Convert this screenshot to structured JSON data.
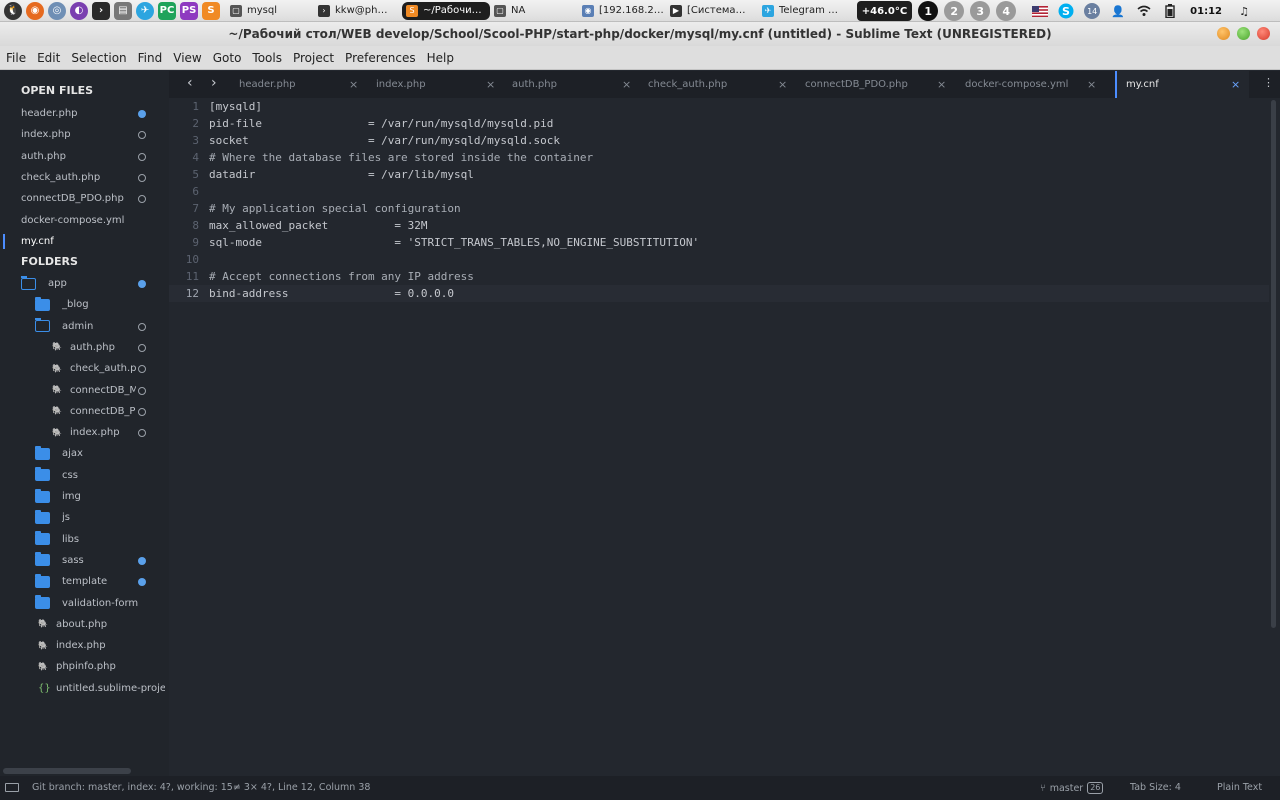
{
  "taskbar": {
    "windows": [
      {
        "label": "mysql",
        "icon_color": "#555555",
        "icon_glyph": "▢"
      },
      {
        "label": "kkw@ph…",
        "icon_color": "#333333",
        "icon_glyph": "›"
      },
      {
        "label": "~/Рабочи…",
        "icon_color": "#f08a24",
        "icon_glyph": "S"
      },
      {
        "label": "NA",
        "icon_color": "#555555",
        "icon_glyph": "▢"
      },
      {
        "label": "[192.168.2…",
        "icon_color": "#5a7fb5",
        "icon_glyph": "◉"
      },
      {
        "label": "[Система…",
        "icon_color": "#333333",
        "icon_glyph": "▶"
      },
      {
        "label": "Telegram …",
        "icon_color": "#2ca5e0",
        "icon_glyph": "✈"
      }
    ],
    "temperature": "+46.0°C",
    "workspaces": [
      "1",
      "2",
      "3",
      "4"
    ],
    "tray_badge": "14",
    "clock": "01:12"
  },
  "title": "~/Рабочий стол/WEB develop/School/Scool-PHP/start-php/docker/mysql/my.cnf (untitled) - Sublime Text (UNREGISTERED)",
  "menu": [
    "File",
    "Edit",
    "Selection",
    "Find",
    "View",
    "Goto",
    "Tools",
    "Project",
    "Preferences",
    "Help"
  ],
  "sidebar": {
    "open_files_heading": "OPEN FILES",
    "open_files": [
      {
        "name": "header.php",
        "status": "modified"
      },
      {
        "name": "index.php",
        "status": "open"
      },
      {
        "name": "auth.php",
        "status": "open"
      },
      {
        "name": "check_auth.php",
        "status": "open"
      },
      {
        "name": "connectDB_PDO.php",
        "status": "open"
      },
      {
        "name": "docker-compose.yml",
        "status": "none"
      },
      {
        "name": "my.cnf",
        "status": "active"
      }
    ],
    "folders_heading": "FOLDERS",
    "tree": [
      {
        "name": "app",
        "kind": "folder-open",
        "indent": 0,
        "status": "modified"
      },
      {
        "name": "_blog",
        "kind": "folder",
        "indent": 1,
        "status": "none"
      },
      {
        "name": "admin",
        "kind": "folder-open",
        "indent": 1,
        "status": "open"
      },
      {
        "name": "auth.php",
        "kind": "php",
        "indent": 2,
        "status": "open"
      },
      {
        "name": "check_auth.php",
        "kind": "php",
        "indent": 2,
        "status": "open"
      },
      {
        "name": "connectDB_MYSQL.php",
        "kind": "php",
        "indent": 2,
        "status": "open"
      },
      {
        "name": "connectDB_PDO.php",
        "kind": "php",
        "indent": 2,
        "status": "open"
      },
      {
        "name": "index.php",
        "kind": "php",
        "indent": 2,
        "status": "open"
      },
      {
        "name": "ajax",
        "kind": "folder",
        "indent": 1,
        "status": "none"
      },
      {
        "name": "css",
        "kind": "folder",
        "indent": 1,
        "status": "none"
      },
      {
        "name": "img",
        "kind": "folder",
        "indent": 1,
        "status": "none"
      },
      {
        "name": "js",
        "kind": "folder",
        "indent": 1,
        "status": "none"
      },
      {
        "name": "libs",
        "kind": "folder",
        "indent": 1,
        "status": "none"
      },
      {
        "name": "sass",
        "kind": "folder",
        "indent": 1,
        "status": "modified"
      },
      {
        "name": "template",
        "kind": "folder",
        "indent": 1,
        "status": "modified"
      },
      {
        "name": "validation-form",
        "kind": "folder",
        "indent": 1,
        "status": "none"
      },
      {
        "name": "about.php",
        "kind": "php",
        "indent": 1,
        "status": "none"
      },
      {
        "name": "index.php",
        "kind": "php",
        "indent": 1,
        "status": "none"
      },
      {
        "name": "phpinfo.php",
        "kind": "php",
        "indent": 1,
        "status": "none"
      },
      {
        "name": "untitled.sublime-project",
        "kind": "json",
        "indent": 1,
        "status": "none"
      }
    ]
  },
  "tabs": [
    {
      "name": "header.php",
      "active": false
    },
    {
      "name": "index.php",
      "active": false
    },
    {
      "name": "auth.php",
      "active": false
    },
    {
      "name": "check_auth.php",
      "active": false
    },
    {
      "name": "connectDB_PDO.php",
      "active": false
    },
    {
      "name": "docker-compose.yml",
      "active": false
    },
    {
      "name": "my.cnf",
      "active": true
    }
  ],
  "editor": {
    "current_line": 12,
    "lines": [
      "[mysqld]",
      "pid-file                = /var/run/mysqld/mysqld.pid",
      "socket                  = /var/run/mysqld/mysqld.sock",
      "# Where the database files are stored inside the container",
      "datadir                 = /var/lib/mysql",
      "",
      "# My application special configuration",
      "max_allowed_packet          = 32M",
      "sql-mode                    = 'STRICT_TRANS_TABLES,NO_ENGINE_SUBSTITUTION'",
      "",
      "# Accept connections from any IP address",
      "bind-address                = 0.0.0.0"
    ]
  },
  "statusbar": {
    "git": "Git branch: master, index: 4?, working: 15≠ 3× 4?, Line 12, Column 38",
    "branch": "master",
    "branch_count": "26",
    "tab_size": "Tab Size: 4",
    "syntax": "Plain Text"
  }
}
